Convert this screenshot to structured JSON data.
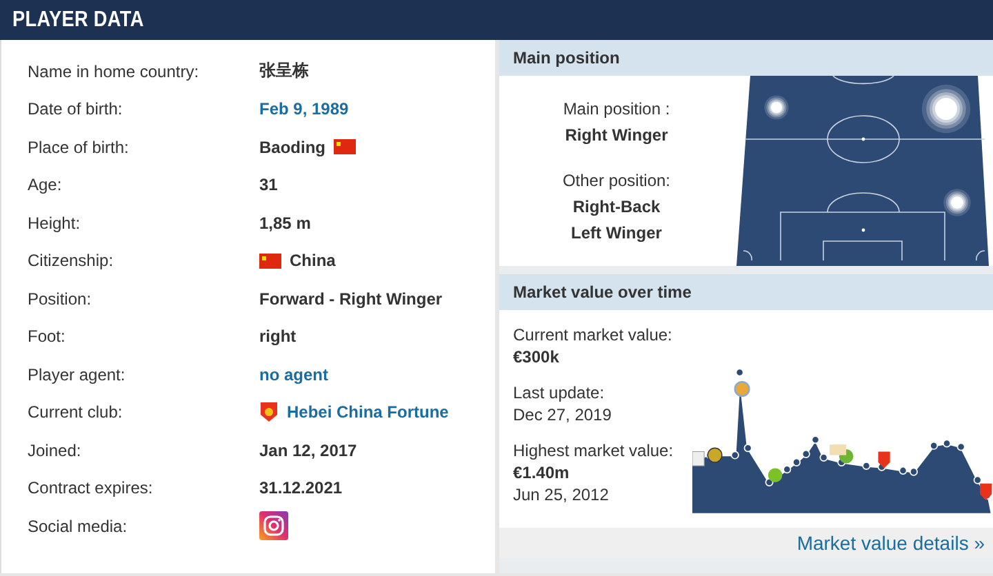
{
  "header": {
    "title": "PLAYER DATA"
  },
  "details": [
    {
      "label": "Name in home country:",
      "kind": "text",
      "value": "张呈栋"
    },
    {
      "label": "Date of birth:",
      "kind": "link",
      "value": "Feb 9, 1989"
    },
    {
      "label": "Place of birth:",
      "kind": "text-flag",
      "value": "Baoding"
    },
    {
      "label": "Age:",
      "kind": "text",
      "value": "31"
    },
    {
      "label": "Height:",
      "kind": "text",
      "value": "1,85 m"
    },
    {
      "label": "Citizenship:",
      "kind": "flag-text",
      "value": "China"
    },
    {
      "label": "Position:",
      "kind": "text",
      "value": "Forward - Right Winger"
    },
    {
      "label": "Foot:",
      "kind": "text",
      "value": "right"
    },
    {
      "label": "Player agent:",
      "kind": "link",
      "value": "no agent"
    },
    {
      "label": "Current club:",
      "kind": "club-link",
      "value": "Hebei China Fortune"
    },
    {
      "label": "Joined:",
      "kind": "text",
      "value": "Jan 12, 2017"
    },
    {
      "label": "Contract expires:",
      "kind": "text",
      "value": "31.12.2021"
    },
    {
      "label": "Social media:",
      "kind": "instagram"
    }
  ],
  "main_position": {
    "title": "Main position",
    "main_label": "Main position :",
    "main": "Right Winger",
    "other_label": "Other position:",
    "others": [
      "Right-Back",
      "Left Winger"
    ]
  },
  "market_value": {
    "title": "Market value over time",
    "current_label": "Current market value:",
    "current": "€300k",
    "update_label": "Last update:",
    "update": "Dec 27, 2019",
    "highest_label": "Highest market value:",
    "highest": "€1.40m",
    "highest_date": "Jun 25, 2012",
    "details_link": "Market value details »"
  }
}
